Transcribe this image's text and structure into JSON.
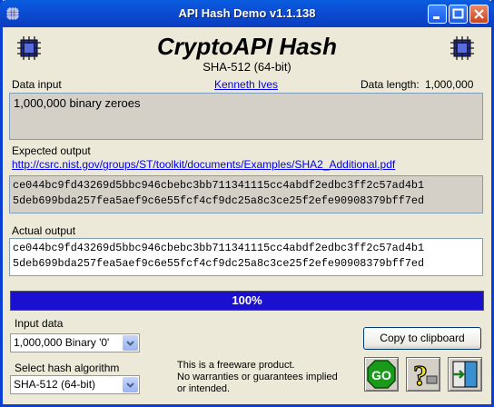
{
  "window": {
    "title": "API Hash Demo v1.1.138",
    "controls": {
      "minimize_icon": "minimize-icon",
      "maximize_icon": "maximize-icon",
      "close_icon": "close-icon"
    }
  },
  "header": {
    "title": "CryptoAPI Hash",
    "subtitle": "SHA-512 (64-bit)",
    "left_icon": "chip-icon",
    "right_icon": "chip-icon"
  },
  "data_input": {
    "label": "Data input",
    "author_link": "Kenneth Ives",
    "length_label": "Data length:",
    "length_value": "1,000,000",
    "value": "1,000,000 binary zeroes"
  },
  "expected": {
    "label": "Expected output",
    "url": "http://csrc.nist.gov/groups/ST/toolkit/documents/Examples/SHA2_Additional.pdf",
    "line1": "ce044bc9fd43269d5bbc946cbebc3bb711341115cc4abdf2edbc3ff2c57ad4b1",
    "line2": "5deb699bda257fea5aef9c6e55fcf4cf9dc25a8c3ce25f2efe90908379bff7ed"
  },
  "actual": {
    "label": "Actual output",
    "line1": "ce044bc9fd43269d5bbc946cbebc3bb711341115cc4abdf2edbc3ff2c57ad4b1",
    "line2": "5deb699bda257fea5aef9c6e55fcf4cf9dc25a8c3ce25f2efe90908379bff7ed"
  },
  "progress": {
    "text": "100%",
    "fraction": 1.0,
    "color": "#1c10d0"
  },
  "controls": {
    "input_data_label": "Input data",
    "input_data_value": "1,000,000 Binary '0'",
    "hash_label": "Select hash algorithm",
    "hash_value": "SHA-512 (64-bit)",
    "copy_button": "Copy to clipboard",
    "freeware_line1": "This is a freeware product.",
    "freeware_line2": "No warranties or guarantees implied",
    "freeware_line3": "or intended.",
    "go_icon": "go-icon",
    "help_icon": "help-icon",
    "exit_icon": "exit-icon"
  }
}
